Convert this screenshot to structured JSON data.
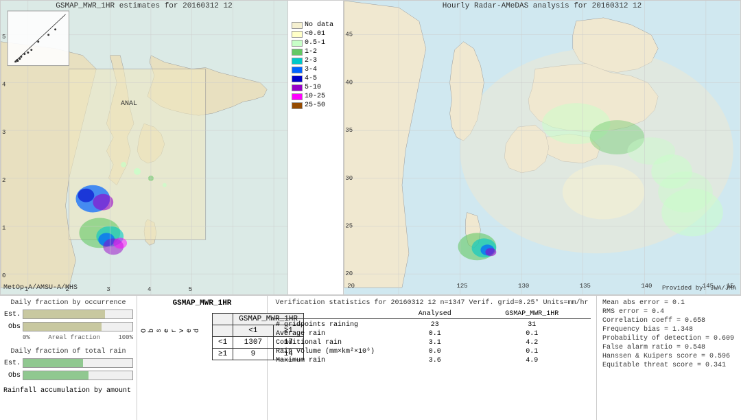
{
  "left_map": {
    "title": "GSMAP_MWR_1HR estimates for 20160312 12",
    "anal_label": "ANAL",
    "metop_label": "MetOp-A/AMSU-A/MHS",
    "provided_label": ""
  },
  "right_map": {
    "title": "Hourly Radar-AMeDAS analysis for 20160312 12",
    "provided_label": "Provided by: JWA/JMA"
  },
  "legend": {
    "title": "",
    "items": [
      {
        "label": "No data",
        "color": "#f5f0d0"
      },
      {
        "label": "<0.01",
        "color": "#ffffc8"
      },
      {
        "label": "0.5-1",
        "color": "#c8ffc8"
      },
      {
        "label": "1-2",
        "color": "#64c864"
      },
      {
        "label": "2-3",
        "color": "#00c8c8"
      },
      {
        "label": "3-4",
        "color": "#0064ff"
      },
      {
        "label": "4-5",
        "color": "#0000c8"
      },
      {
        "label": "5-10",
        "color": "#9600c8"
      },
      {
        "label": "10-25",
        "color": "#ff00ff"
      },
      {
        "label": "25-50",
        "color": "#964b00"
      }
    ]
  },
  "histogram": {
    "daily_fraction_title": "Daily fraction by occurrence",
    "daily_rain_title": "Daily fraction of total rain",
    "rainfall_title": "Rainfall accumulation by amount",
    "bars": [
      {
        "label": "Est.",
        "fill_pct": 75,
        "color": "#c8c8a0"
      },
      {
        "label": "Obs",
        "fill_pct": 72,
        "color": "#c8c8a0"
      }
    ],
    "rain_bars": [
      {
        "label": "Est.",
        "fill_pct": 55,
        "color": "#90c890"
      },
      {
        "label": "Obs",
        "fill_pct": 60,
        "color": "#90c890"
      }
    ],
    "axis_labels": [
      "0%",
      "Areal fraction",
      "100%"
    ]
  },
  "contingency": {
    "title": "GSMAP_MWR_1HR",
    "header_cols": [
      "<1",
      "≥1"
    ],
    "row_labels": [
      "<1",
      "≥1"
    ],
    "obs_label": "O\nb\ns\ne\nr\nv\ne\nd",
    "values": [
      [
        1307,
        17
      ],
      [
        9,
        14
      ]
    ]
  },
  "verification": {
    "title": "Verification statistics for 20160312 12  n=1347  Verif. grid=0.25°  Units=mm/hr",
    "col_headers": [
      "Analysed",
      "GSMAP_MWR_1HR"
    ],
    "rows": [
      {
        "label": "# gridpoints raining",
        "analysed": "23",
        "gsmap": "31"
      },
      {
        "label": "Average rain",
        "analysed": "0.1",
        "gsmap": "0.1"
      },
      {
        "label": "Conditional rain",
        "analysed": "3.1",
        "gsmap": "4.2"
      },
      {
        "label": "Rain volume (mm×km²×10⁶)",
        "analysed": "0.0",
        "gsmap": "0.1"
      },
      {
        "label": "Maximum rain",
        "analysed": "3.6",
        "gsmap": "4.9"
      }
    ]
  },
  "scores": {
    "lines": [
      "Mean abs error = 0.1",
      "RMS error = 0.4",
      "Correlation coeff = 0.658",
      "Frequency bias = 1.348",
      "Probability of detection = 0.609",
      "False alarm ratio = 0.548",
      "Hanssen & Kuipers score = 0.596",
      "Equitable threat score = 0.341"
    ]
  },
  "lat_labels_left": [
    "5",
    "4",
    "3",
    "2",
    "1",
    "0"
  ],
  "lat_labels_right": [
    "45",
    "40",
    "35",
    "30",
    "25",
    "20"
  ],
  "lon_labels_right": [
    "125",
    "130",
    "135",
    "140",
    "145"
  ],
  "lon_labels_left": [
    "1",
    "2",
    "3",
    "4",
    "5"
  ]
}
